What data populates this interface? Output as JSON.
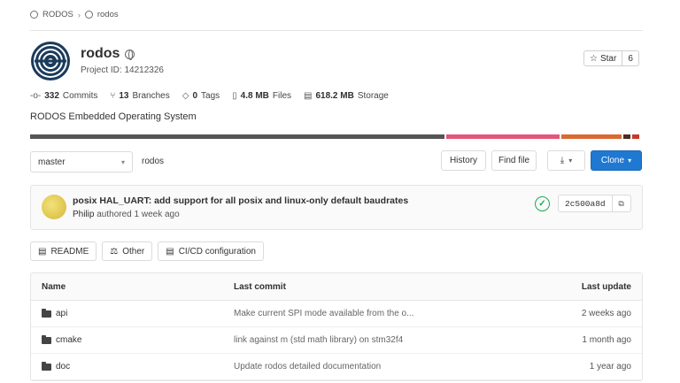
{
  "breadcrumb": [
    "RODOS",
    "rodos"
  ],
  "project": {
    "name": "rodos",
    "id_label": "Project ID: 14212326",
    "description": "RODOS Embedded Operating System"
  },
  "star": {
    "label": "Star",
    "count": "6"
  },
  "stats": [
    {
      "icon": "commit-icon",
      "value": "332",
      "label": "Commits"
    },
    {
      "icon": "branch-icon",
      "value": "13",
      "label": "Branches"
    },
    {
      "icon": "tag-icon",
      "value": "0",
      "label": "Tags"
    },
    {
      "icon": "file-icon",
      "value": "4.8 MB",
      "label": "Files"
    },
    {
      "icon": "storage-icon",
      "value": "618.2 MB",
      "label": "Storage"
    }
  ],
  "language_bar": [
    {
      "color": "#555555",
      "fraction": 0.688
    },
    {
      "color": "#e4567b",
      "fraction": 0.188
    },
    {
      "color": "#da6a31",
      "fraction": 0.1
    },
    {
      "color": "#4d2c24",
      "fraction": 0.012
    },
    {
      "color": "#c8382a",
      "fraction": 0.012
    }
  ],
  "repo_nav": {
    "branch": "master",
    "path": "rodos",
    "history": "History",
    "find_file": "Find file",
    "clone": "Clone"
  },
  "last_commit": {
    "title": "posix HAL_UART: add support for all posix and linux-only default baudrates",
    "author": "Philip",
    "meta": "authored 1 week ago",
    "sha": "2c500a8d"
  },
  "quick_links": [
    "README",
    "Other",
    "CI/CD configuration"
  ],
  "file_table": {
    "headers": {
      "name": "Name",
      "last_commit": "Last commit",
      "last_update": "Last update"
    },
    "rows": [
      {
        "name": "api",
        "commit": "Make current SPI mode available from the o...",
        "date": "2 weeks ago"
      },
      {
        "name": "cmake",
        "commit": "link against m (std math library) on stm32f4",
        "date": "1 month ago"
      },
      {
        "name": "doc",
        "commit": "Update rodos detailed documentation",
        "date": "1 year ago"
      }
    ]
  },
  "colors": {
    "accent": "#1f78d1",
    "success": "#1aaa55"
  }
}
